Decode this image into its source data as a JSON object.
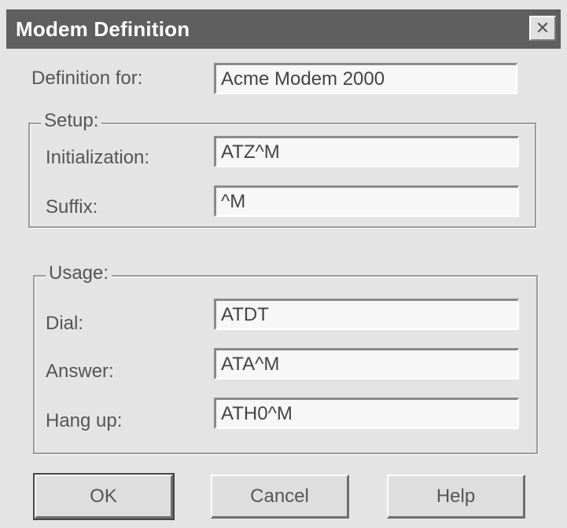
{
  "window": {
    "title": "Modem Definition",
    "close_glyph": "✕"
  },
  "definition": {
    "label": "Definition for:",
    "value": "Acme Modem 2000"
  },
  "setup": {
    "legend": "Setup:",
    "initialization_label": "Initialization:",
    "initialization_value": "ATZ^M",
    "suffix_label": "Suffix:",
    "suffix_value": "^M"
  },
  "usage": {
    "legend": "Usage:",
    "dial_label": "Dial:",
    "dial_value": "ATDT",
    "answer_label": "Answer:",
    "answer_value": "ATA^M",
    "hangup_label": "Hang up:",
    "hangup_value": "ATH0^M"
  },
  "buttons": {
    "ok": "OK",
    "cancel": "Cancel",
    "help": "Help"
  }
}
